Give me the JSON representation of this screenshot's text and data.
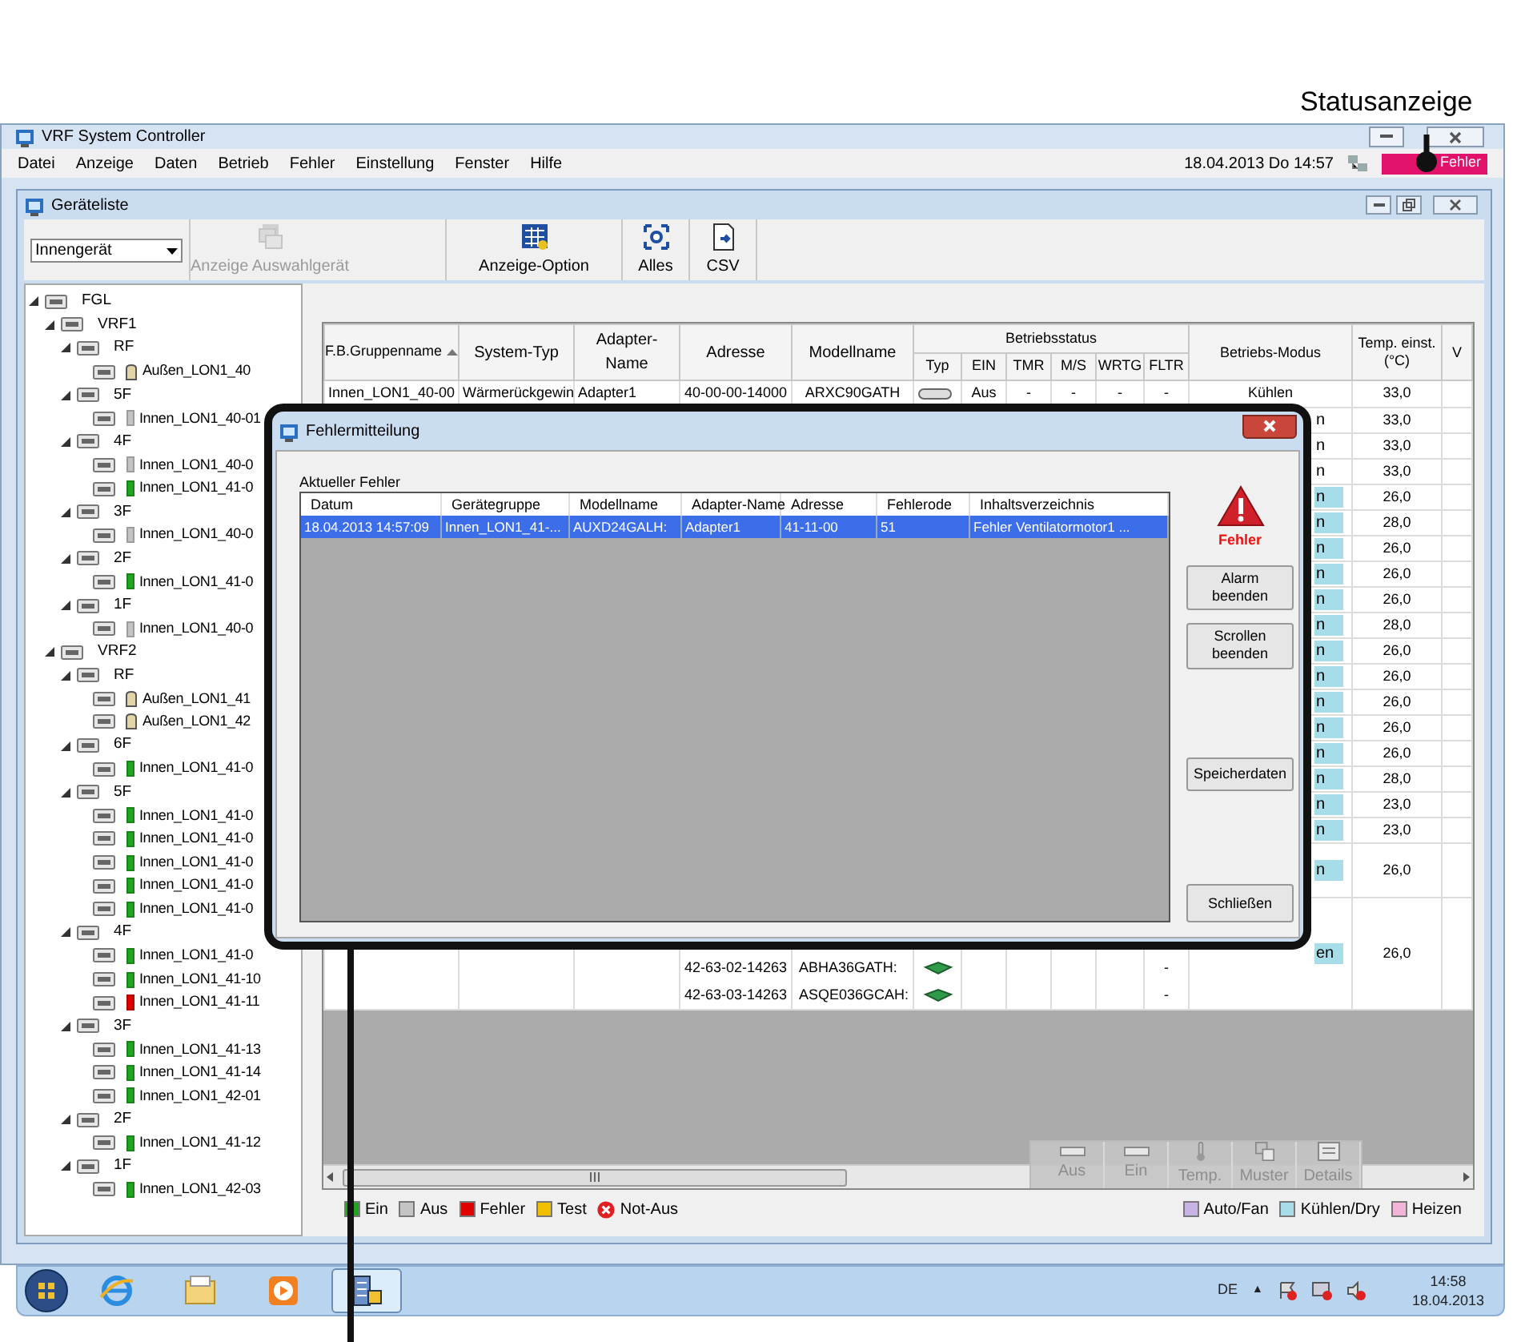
{
  "annotation": {
    "label": "Statusanzeige"
  },
  "window": {
    "title": "VRF System Controller"
  },
  "menu": [
    "Datei",
    "Anzeige",
    "Daten",
    "Betrieb",
    "Fehler",
    "Einstellung",
    "Fenster",
    "Hilfe"
  ],
  "clock": "18.04.2013 Do 14:57",
  "status": {
    "label": "Fehler",
    "kind": "error"
  },
  "device_window": {
    "title": "Geräteliste",
    "dropdown": {
      "value": "Innengerät"
    },
    "toolbar": [
      {
        "label": "Anzeige Auswahlgerät",
        "kind": "select-device",
        "disabled": true
      },
      {
        "label": "Anzeige-Option",
        "kind": "options",
        "disabled": false
      },
      {
        "label": "Alles",
        "kind": "all",
        "disabled": false
      },
      {
        "label": "CSV",
        "kind": "csv",
        "disabled": false
      }
    ],
    "tree": [
      {
        "label": "FGL",
        "expanded": true,
        "children": [
          {
            "label": "VRF1",
            "expanded": true,
            "children": [
              {
                "label": "RF",
                "expanded": true,
                "children": [
                  {
                    "label": "Außen_LON1_40",
                    "kind": "outdoor"
                  }
                ]
              },
              {
                "label": "5F",
                "expanded": true,
                "children": [
                  {
                    "label": "Innen_LON1_40-01",
                    "kind": "indoor",
                    "color": "#c4c4c4"
                  }
                ]
              },
              {
                "label": "4F",
                "expanded": true,
                "children": [
                  {
                    "label": "Innen_LON1_40-0",
                    "kind": "indoor",
                    "color": "#c4c4c4"
                  },
                  {
                    "label": "Innen_LON1_41-0",
                    "kind": "indoor",
                    "color": "#1fa51f"
                  }
                ]
              },
              {
                "label": "3F",
                "expanded": true,
                "children": [
                  {
                    "label": "Innen_LON1_40-0",
                    "kind": "indoor",
                    "color": "#c4c4c4"
                  }
                ]
              },
              {
                "label": "2F",
                "expanded": true,
                "children": [
                  {
                    "label": "Innen_LON1_41-0",
                    "kind": "indoor",
                    "color": "#1fa51f"
                  }
                ]
              },
              {
                "label": "1F",
                "expanded": true,
                "children": [
                  {
                    "label": "Innen_LON1_40-0",
                    "kind": "indoor",
                    "color": "#c4c4c4"
                  }
                ]
              }
            ]
          },
          {
            "label": "VRF2",
            "expanded": true,
            "children": [
              {
                "label": "RF",
                "expanded": true,
                "children": [
                  {
                    "label": "Außen_LON1_41",
                    "kind": "outdoor"
                  },
                  {
                    "label": "Außen_LON1_42",
                    "kind": "outdoor"
                  }
                ]
              },
              {
                "label": "6F",
                "expanded": true,
                "children": [
                  {
                    "label": "Innen_LON1_41-0",
                    "kind": "indoor",
                    "color": "#1fa51f"
                  }
                ]
              },
              {
                "label": "5F",
                "expanded": true,
                "children": [
                  {
                    "label": "Innen_LON1_41-0",
                    "kind": "indoor",
                    "color": "#1fa51f"
                  },
                  {
                    "label": "Innen_LON1_41-0",
                    "kind": "indoor",
                    "color": "#1fa51f"
                  },
                  {
                    "label": "Innen_LON1_41-0",
                    "kind": "indoor",
                    "color": "#1fa51f"
                  },
                  {
                    "label": "Innen_LON1_41-0",
                    "kind": "indoor",
                    "color": "#1fa51f"
                  },
                  {
                    "label": "Innen_LON1_41-0",
                    "kind": "indoor",
                    "color": "#1fa51f"
                  }
                ]
              },
              {
                "label": "4F",
                "expanded": true,
                "children": [
                  {
                    "label": "Innen_LON1_41-0",
                    "kind": "indoor",
                    "color": "#1fa51f"
                  },
                  {
                    "label": "Innen_LON1_41-10",
                    "kind": "indoor",
                    "color": "#1fa51f"
                  },
                  {
                    "label": "Innen_LON1_41-11",
                    "kind": "indoor",
                    "color": "#e00000"
                  }
                ]
              },
              {
                "label": "3F",
                "expanded": true,
                "children": [
                  {
                    "label": "Innen_LON1_41-13",
                    "kind": "indoor",
                    "color": "#1fa51f"
                  },
                  {
                    "label": "Innen_LON1_41-14",
                    "kind": "indoor",
                    "color": "#1fa51f"
                  },
                  {
                    "label": "Innen_LON1_42-01",
                    "kind": "indoor",
                    "color": "#1fa51f"
                  }
                ]
              },
              {
                "label": "2F",
                "expanded": true,
                "children": [
                  {
                    "label": "Innen_LON1_41-12",
                    "kind": "indoor",
                    "color": "#1fa51f"
                  }
                ]
              },
              {
                "label": "1F",
                "expanded": true,
                "children": [
                  {
                    "label": "Innen_LON1_42-03",
                    "kind": "indoor",
                    "color": "#1fa51f"
                  }
                ]
              }
            ]
          }
        ]
      }
    ],
    "table": {
      "columns": [
        {
          "label": "F.B.Gruppenname",
          "sorted": true
        },
        {
          "label": "System-Typ"
        },
        {
          "label": "Adapter-Name"
        },
        {
          "label": "Adresse"
        },
        {
          "label": "Modellname"
        }
      ],
      "status_group": {
        "label": "Betriebsstatus",
        "columns": [
          "Typ",
          "EIN",
          "TMR",
          "M/S",
          "WRTG",
          "FLTR"
        ]
      },
      "after_columns": [
        {
          "label": "Betriebs-Modus"
        },
        {
          "label": "Temp. einst. (°C)"
        },
        {
          "label": "V"
        }
      ],
      "rows": [
        {
          "kind": "full",
          "cells": [
            "Innen_LON1_40-00",
            "Wärmerückgewin",
            "Adapter1",
            "40-00-00-14000",
            "ARXC90GATH"
          ],
          "status": [
            "Aus",
            "-",
            "-",
            "-",
            "-"
          ],
          "mode": "Kühlen",
          "temp": "33,0"
        },
        {
          "kind": "covered",
          "mode": "n",
          "highlighted": false,
          "temp": "33,0"
        },
        {
          "kind": "covered",
          "mode": "n",
          "highlighted": false,
          "temp": "33,0"
        },
        {
          "kind": "covered",
          "mode": "n",
          "highlighted": false,
          "temp": "33,0"
        },
        {
          "kind": "covered",
          "mode": "n",
          "highlighted": true,
          "temp": "26,0"
        },
        {
          "kind": "covered",
          "mode": "n",
          "highlighted": true,
          "temp": "28,0"
        },
        {
          "kind": "covered",
          "mode": "n",
          "highlighted": true,
          "temp": "26,0"
        },
        {
          "kind": "covered",
          "mode": "n",
          "highlighted": true,
          "temp": "26,0"
        },
        {
          "kind": "covered",
          "mode": "n",
          "highlighted": true,
          "temp": "26,0"
        },
        {
          "kind": "covered",
          "mode": "n",
          "highlighted": true,
          "temp": "28,0"
        },
        {
          "kind": "covered",
          "mode": "n",
          "highlighted": true,
          "temp": "26,0"
        },
        {
          "kind": "covered",
          "mode": "n",
          "highlighted": true,
          "temp": "26,0"
        },
        {
          "kind": "covered",
          "mode": "n",
          "highlighted": true,
          "temp": "26,0"
        },
        {
          "kind": "covered",
          "mode": "n",
          "highlighted": true,
          "temp": "26,0"
        },
        {
          "kind": "covered",
          "mode": "n",
          "highlighted": true,
          "temp": "26,0"
        },
        {
          "kind": "covered",
          "mode": "n",
          "highlighted": true,
          "temp": "28,0"
        },
        {
          "kind": "covered",
          "mode": "n",
          "highlighted": true,
          "temp": "23,0"
        },
        {
          "kind": "covered",
          "mode": "n",
          "highlighted": true,
          "temp": "23,0"
        },
        {
          "kind": "covered",
          "mode": "n",
          "highlighted": true,
          "temp": "26,0"
        },
        {
          "kind": "split",
          "mode": "en",
          "highlighted": true,
          "temp": "26,0",
          "subrows": [
            {
              "address": "42-63-02-14263",
              "model": "ABHA36GATH:",
              "fltr": "-"
            },
            {
              "address": "42-63-03-14263",
              "model": "ASQE036GCAH:",
              "fltr": "-"
            }
          ]
        }
      ]
    },
    "floating_toolbar": [
      {
        "label": "Aus",
        "kind": "off",
        "disabled": true
      },
      {
        "label": "Ein",
        "kind": "on",
        "disabled": true
      },
      {
        "label": "Temp.",
        "kind": "temp",
        "disabled": true
      },
      {
        "label": "Muster",
        "kind": "pattern",
        "disabled": true
      },
      {
        "label": "Details",
        "kind": "details",
        "disabled": true
      }
    ],
    "legend_left": [
      {
        "label": "Ein",
        "kind": "swatch",
        "color": "#1fa51f"
      },
      {
        "label": "Aus",
        "kind": "swatch",
        "color": "#c4c4c4"
      },
      {
        "label": "Fehler",
        "kind": "swatch",
        "color": "#e00000"
      },
      {
        "label": "Test",
        "kind": "swatch",
        "color": "#f0c000"
      },
      {
        "label": "Not-Aus",
        "kind": "stop"
      }
    ],
    "legend_right": [
      {
        "label": "Auto/Fan",
        "kind": "swatch",
        "color": "#c8b4e4"
      },
      {
        "label": "Kühlen/Dry",
        "kind": "swatch",
        "color": "#a6dde9"
      },
      {
        "label": "Heizen",
        "kind": "swatch",
        "color": "#f2b4d8"
      }
    ]
  },
  "dialog": {
    "title": "Fehlermitteilung",
    "section": "Aktueller Fehler",
    "columns": [
      "Datum",
      "Gerätegruppe",
      "Modellname",
      "Adapter-Name",
      "Adresse",
      "Fehlerode",
      "Inhaltsverzeichnis"
    ],
    "rows": [
      {
        "selected": true,
        "cells": [
          "18.04.2013 14:57:09",
          "Innen_LON1_41-...",
          "AUXD24GALH:",
          "Adapter1",
          "41-11-00",
          "51",
          "Fehler Ventilatormotor1 ..."
        ]
      }
    ],
    "alert": "Fehler",
    "buttons": [
      {
        "label": "Alarm beenden",
        "kind": "alarm"
      },
      {
        "label": "Scrollen beenden",
        "kind": "scroll"
      },
      {
        "label": "Speicherdaten",
        "kind": "save"
      },
      {
        "label": "Schließen",
        "kind": "close"
      }
    ]
  },
  "taskbar": {
    "apps": [
      {
        "kind": "ie",
        "active": false
      },
      {
        "kind": "explorer",
        "active": false
      },
      {
        "kind": "media",
        "active": false
      },
      {
        "kind": "controller",
        "active": true
      }
    ],
    "language": "DE",
    "tray_arrow": "▲",
    "time": "14:58",
    "date": "18.04.2013"
  }
}
